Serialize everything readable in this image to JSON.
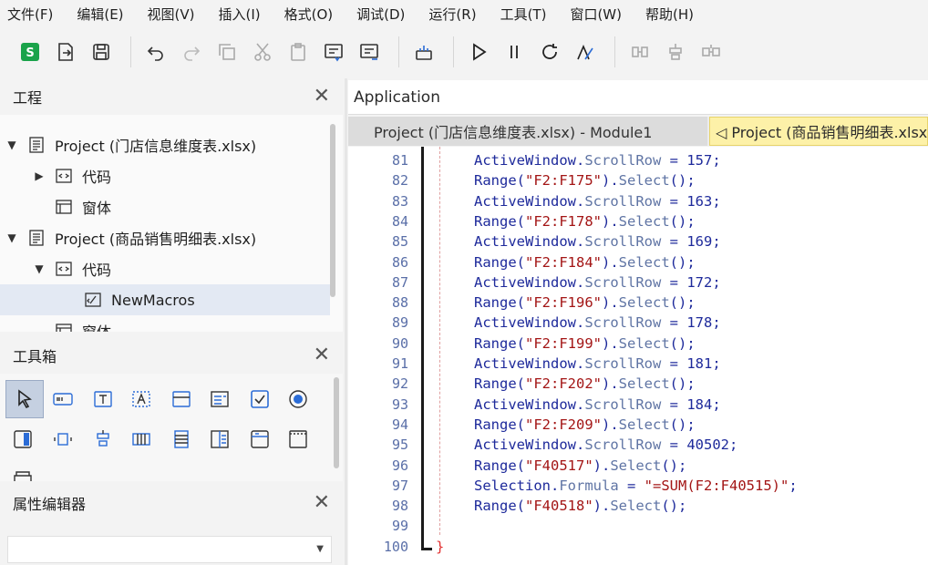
{
  "menu": [
    "文件(F)",
    "编辑(E)",
    "视图(V)",
    "插入(I)",
    "格式(O)",
    "调试(D)",
    "运行(R)",
    "工具(T)",
    "窗口(W)",
    "帮助(H)"
  ],
  "toolbar_icons": [
    "wps-logo-icon",
    "export-icon",
    "save-icon",
    "undo-icon",
    "redo-icon",
    "copy-icon",
    "cut-icon",
    "paste-icon",
    "macro-list-icon",
    "macro-edit-icon",
    "toolbox-icon",
    "run-icon",
    "pause-icon",
    "reset-icon",
    "design-mode-icon",
    "step-into-icon",
    "step-over-icon",
    "step-out-icon"
  ],
  "panels": {
    "project": "工程",
    "toolbox": "工具箱",
    "properties": "属性编辑器",
    "close_glyph": "✕"
  },
  "tree": [
    {
      "label": "Project (门店信息维度表.xlsx)",
      "icon": "project-icon",
      "twisty": "▼"
    },
    {
      "label": "代码",
      "icon": "code-folder-icon",
      "twisty": "▶"
    },
    {
      "label": "窗体",
      "icon": "form-icon",
      "twisty": ""
    },
    {
      "label": "Project (商品销售明细表.xlsx)",
      "icon": "project-icon",
      "twisty": "▼"
    },
    {
      "label": "代码",
      "icon": "code-folder-icon",
      "twisty": "▼"
    },
    {
      "label": "NewMacros",
      "icon": "module-icon",
      "twisty": ""
    },
    {
      "label": "窗体",
      "icon": "form-icon",
      "twisty": ""
    }
  ],
  "editor": {
    "app_title": "Application",
    "tab_active": "Project (门店信息维度表.xlsx) - Module1",
    "tab_other": "◁ Project (商品销售明细表.xlsx)",
    "lines": [
      {
        "n": "81",
        "a": "ActiveWindow",
        "b": "ScrollRow",
        "c": " = 157;"
      },
      {
        "n": "82",
        "r": "\"F2:F175\""
      },
      {
        "n": "83",
        "a": "ActiveWindow",
        "b": "ScrollRow",
        "c": " = 163;"
      },
      {
        "n": "84",
        "r": "\"F2:F178\""
      },
      {
        "n": "85",
        "a": "ActiveWindow",
        "b": "ScrollRow",
        "c": " = 169;"
      },
      {
        "n": "86",
        "r": "\"F2:F184\""
      },
      {
        "n": "87",
        "a": "ActiveWindow",
        "b": "ScrollRow",
        "c": " = 172;"
      },
      {
        "n": "88",
        "r": "\"F2:F196\""
      },
      {
        "n": "89",
        "a": "ActiveWindow",
        "b": "ScrollRow",
        "c": " = 178;"
      },
      {
        "n": "90",
        "r": "\"F2:F199\""
      },
      {
        "n": "91",
        "a": "ActiveWindow",
        "b": "ScrollRow",
        "c": " = 181;"
      },
      {
        "n": "92",
        "r": "\"F2:F202\""
      },
      {
        "n": "93",
        "a": "ActiveWindow",
        "b": "ScrollRow",
        "c": " = 184;"
      },
      {
        "n": "94",
        "r": "\"F2:F209\""
      },
      {
        "n": "95",
        "a": "ActiveWindow",
        "b": "ScrollRow",
        "c": " = 40502;"
      },
      {
        "n": "96",
        "r": "\"F40517\""
      },
      {
        "n": "97",
        "a": "Selection",
        "b": "Formula",
        "c": " = ",
        "s": "\"=SUM(F2:F40515)\"",
        "e": ";"
      },
      {
        "n": "98",
        "r": "\"F40518\""
      },
      {
        "n": "99"
      },
      {
        "n": "100",
        "brace": "}"
      }
    ],
    "range_kw": "Range(",
    "select_tail": ").",
    "select_fn": "Select",
    "select_end": "();"
  },
  "colors": {
    "accent": "#1e2a9b",
    "string": "#a31515",
    "tab_highlight": "#fdf1a8"
  }
}
